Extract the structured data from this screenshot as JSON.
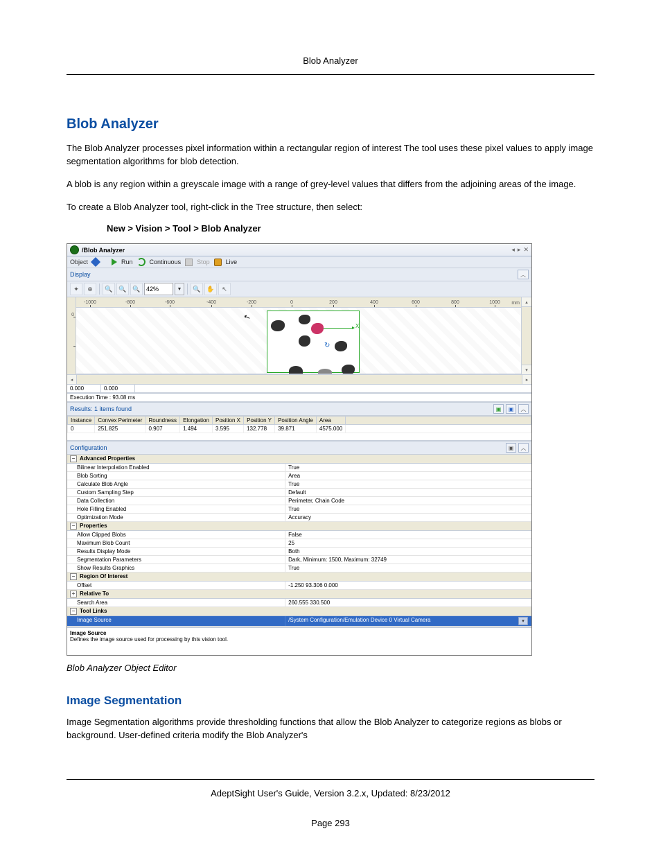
{
  "header": {
    "title": "Blob Analyzer"
  },
  "h1": "Blob Analyzer",
  "p1": "The Blob Analyzer processes pixel information within a rectangular region of interest The tool uses these pixel values to apply image segmentation algorithms for blob detection.",
  "p2": "A blob is any region within a greyscale image with a range of grey-level values that differs from the adjoining areas of the image.",
  "p3": "To create a Blob Analyzer tool, right-click in the Tree structure, then select:",
  "menu_path": "New > Vision > Tool > Blob Analyzer",
  "fig_caption": "Blob Analyzer Object Editor",
  "h2": "Image Segmentation",
  "p4": "Image Segmentation algorithms provide thresholding functions that allow the Blob Analyzer to categorize regions as blobs or background. User-defined criteria modify the Blob Analyzer's",
  "footer": {
    "line": "AdeptSight User's Guide,  Version 3.2.x, Updated: 8/23/2012",
    "page": "Page 293"
  },
  "app": {
    "title_path": "/Blob Analyzer",
    "actions": {
      "object": "Object",
      "run": "Run",
      "continuous": "Continuous",
      "stop": "Stop",
      "live": "Live"
    },
    "display_label": "Display",
    "zoom": "42%",
    "ruler": {
      "x_ticks": [
        "-1000",
        "-800",
        "-600",
        "-400",
        "-200",
        "0",
        "200",
        "400",
        "600",
        "800",
        "1000"
      ],
      "x_positions": [
        20,
        78,
        135,
        195,
        253,
        311,
        371,
        430,
        490,
        547,
        604
      ],
      "units": "mm",
      "y_ticks": [
        {
          "lbl": "0",
          "top": 26
        }
      ]
    },
    "axis_x_lbl": "X",
    "status": {
      "a": "0.000",
      "b": "0.000"
    },
    "exec_time": "Execution Time : 93.08 ms",
    "results": {
      "header": "Results: 1 items found",
      "columns": [
        "Instance",
        "Convex Perimeter",
        "Roundness",
        "Elongation",
        "Position X",
        "Position Y",
        "Position Angle",
        "Area"
      ],
      "row": [
        "0",
        "251.825",
        "0.907",
        "1.494",
        "3.595",
        "132.778",
        "39.871",
        "4575.000"
      ]
    },
    "config_label": "Configuration",
    "props": {
      "cat_adv": "Advanced Properties",
      "adv": [
        {
          "k": "Bilinear Interpolation Enabled",
          "v": "True"
        },
        {
          "k": "Blob Sorting",
          "v": "Area"
        },
        {
          "k": "Calculate Blob Angle",
          "v": "True"
        },
        {
          "k": "Custom Sampling Step",
          "v": "Default"
        },
        {
          "k": "Data Collection",
          "v": "Perimeter, Chain Code"
        },
        {
          "k": "Hole Filling Enabled",
          "v": "True"
        },
        {
          "k": "Optimization Mode",
          "v": "Accuracy"
        }
      ],
      "cat_props": "Properties",
      "main": [
        {
          "k": "Allow Clipped Blobs",
          "v": "False"
        },
        {
          "k": "Maximum Blob Count",
          "v": "25"
        },
        {
          "k": "Results Display Mode",
          "v": "Both"
        },
        {
          "k": "Segmentation Parameters",
          "v": "Dark, Minimum: 1500, Maximum: 32749"
        },
        {
          "k": "Show Results Graphics",
          "v": "True"
        }
      ],
      "cat_roi": "Region Of Interest",
      "roi": [
        {
          "k": "Offset",
          "v": "-1.250 93.306 0.000"
        }
      ],
      "cat_rel": "Relative To",
      "rel": [
        {
          "k": "Search Area",
          "v": "260.555 330.500"
        }
      ],
      "cat_tl": "Tool Links",
      "tl_sel": {
        "k": "Image Source",
        "v": "/System Configuration/Emulation Device 0 Virtual Camera"
      }
    },
    "desc": {
      "title": "Image Source",
      "text": "Defines the image source used for processing by this vision tool."
    }
  }
}
